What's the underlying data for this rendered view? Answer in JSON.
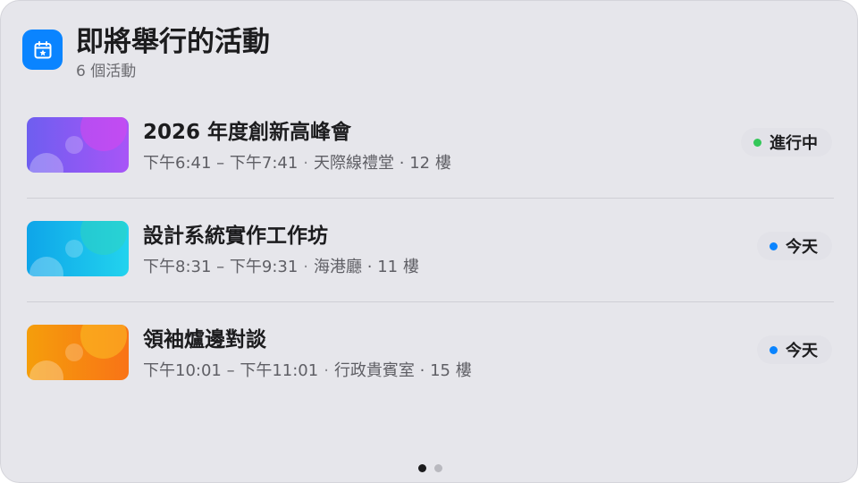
{
  "header": {
    "icon": "calendar-star-icon",
    "title": "即將舉行的活動",
    "subtitle": "6 個活動"
  },
  "events": [
    {
      "title": "2026 年度創新高峰會",
      "time": "下午6:41 – 下午7:41",
      "location": "天際線禮堂 · 12 樓",
      "status": "進行中",
      "status_color": "#34c759",
      "thumb_colors": [
        "#6e5ef0",
        "#a855f7",
        "#d946ef"
      ]
    },
    {
      "title": "設計系統實作工作坊",
      "time": "下午8:31 – 下午9:31",
      "location": "海港廳 · 11 樓",
      "status": "今天",
      "status_color": "#0a84ff",
      "thumb_colors": [
        "#0ea5e9",
        "#22d3ee",
        "#2dd4bf"
      ]
    },
    {
      "title": "領袖爐邊對談",
      "time": "下午10:01 – 下午11:01",
      "location": "行政貴賓室 · 15 樓",
      "status": "今天",
      "status_color": "#0a84ff",
      "thumb_colors": [
        "#f59e0b",
        "#f97316",
        "#fbbf24"
      ]
    }
  ],
  "pager": {
    "pages": 2,
    "current": 1
  },
  "colors": {
    "accent": "#0a84ff",
    "background": "#e6e6eb"
  }
}
